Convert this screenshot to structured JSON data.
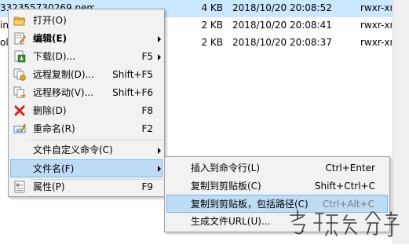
{
  "file_list": {
    "rows": [
      {
        "name": "33235573026​9.pem",
        "size": "4 KB",
        "date": "2018/10/20 20:08:52",
        "perm": "rwxr-xr"
      },
      {
        "name": "in",
        "size": "2 KB",
        "date": "2018/10/20 20:08:41",
        "perm": "rwxr-xr"
      },
      {
        "name": "oli",
        "size": "2 KB",
        "date": "2018/10/20 20:08:37",
        "perm": "rwxr-xr"
      }
    ]
  },
  "context_menu": {
    "items": [
      {
        "icon": "folder-open-icon",
        "label": "打开(O)",
        "shortcut": "",
        "has_submenu": false
      },
      {
        "icon": "edit-icon",
        "label": "编辑(E)",
        "shortcut": "",
        "has_submenu": true
      },
      {
        "icon": "download-icon",
        "label": "下载(D)...",
        "shortcut": "F5",
        "has_submenu": true
      },
      {
        "icon": "remote-copy-icon",
        "label": "远程复制(D)...",
        "shortcut": "Shift+F5",
        "has_submenu": false
      },
      {
        "icon": "remote-move-icon",
        "label": "远程移动(V)...",
        "shortcut": "Shift+F6",
        "has_submenu": false
      },
      {
        "icon": "delete-icon",
        "label": "删除(D)",
        "shortcut": "F8",
        "has_submenu": false
      },
      {
        "icon": "rename-icon",
        "label": "重命名(R)",
        "shortcut": "F2",
        "has_submenu": false
      },
      {
        "icon": "",
        "label": "文件自定义命令(C)",
        "shortcut": "",
        "has_submenu": true
      },
      {
        "icon": "",
        "label": "文件名(F)",
        "shortcut": "",
        "has_submenu": true,
        "highlighted": true
      },
      {
        "icon": "properties-icon",
        "label": "属性(P)",
        "shortcut": "F9",
        "has_submenu": false
      }
    ]
  },
  "submenu": {
    "items": [
      {
        "label": "插入到命令行(L)",
        "shortcut": "Ctrl+Enter"
      },
      {
        "label": "复制到剪贴板(C)",
        "shortcut": "Shift+Ctrl+C"
      },
      {
        "label": "复制到剪贴板，包括路径(C)",
        "shortcut": "Ctrl+Alt+C",
        "highlighted": true
      },
      {
        "label": "生成文件URL(U)...",
        "shortcut": ""
      }
    ]
  },
  "colors": {
    "menu_bg": "#f2f2f2",
    "highlight_bg": "#bfdcf6",
    "highlight_border": "#7ab6e8",
    "selected_row": "#cce8ff",
    "delete_red": "#d32020"
  }
}
